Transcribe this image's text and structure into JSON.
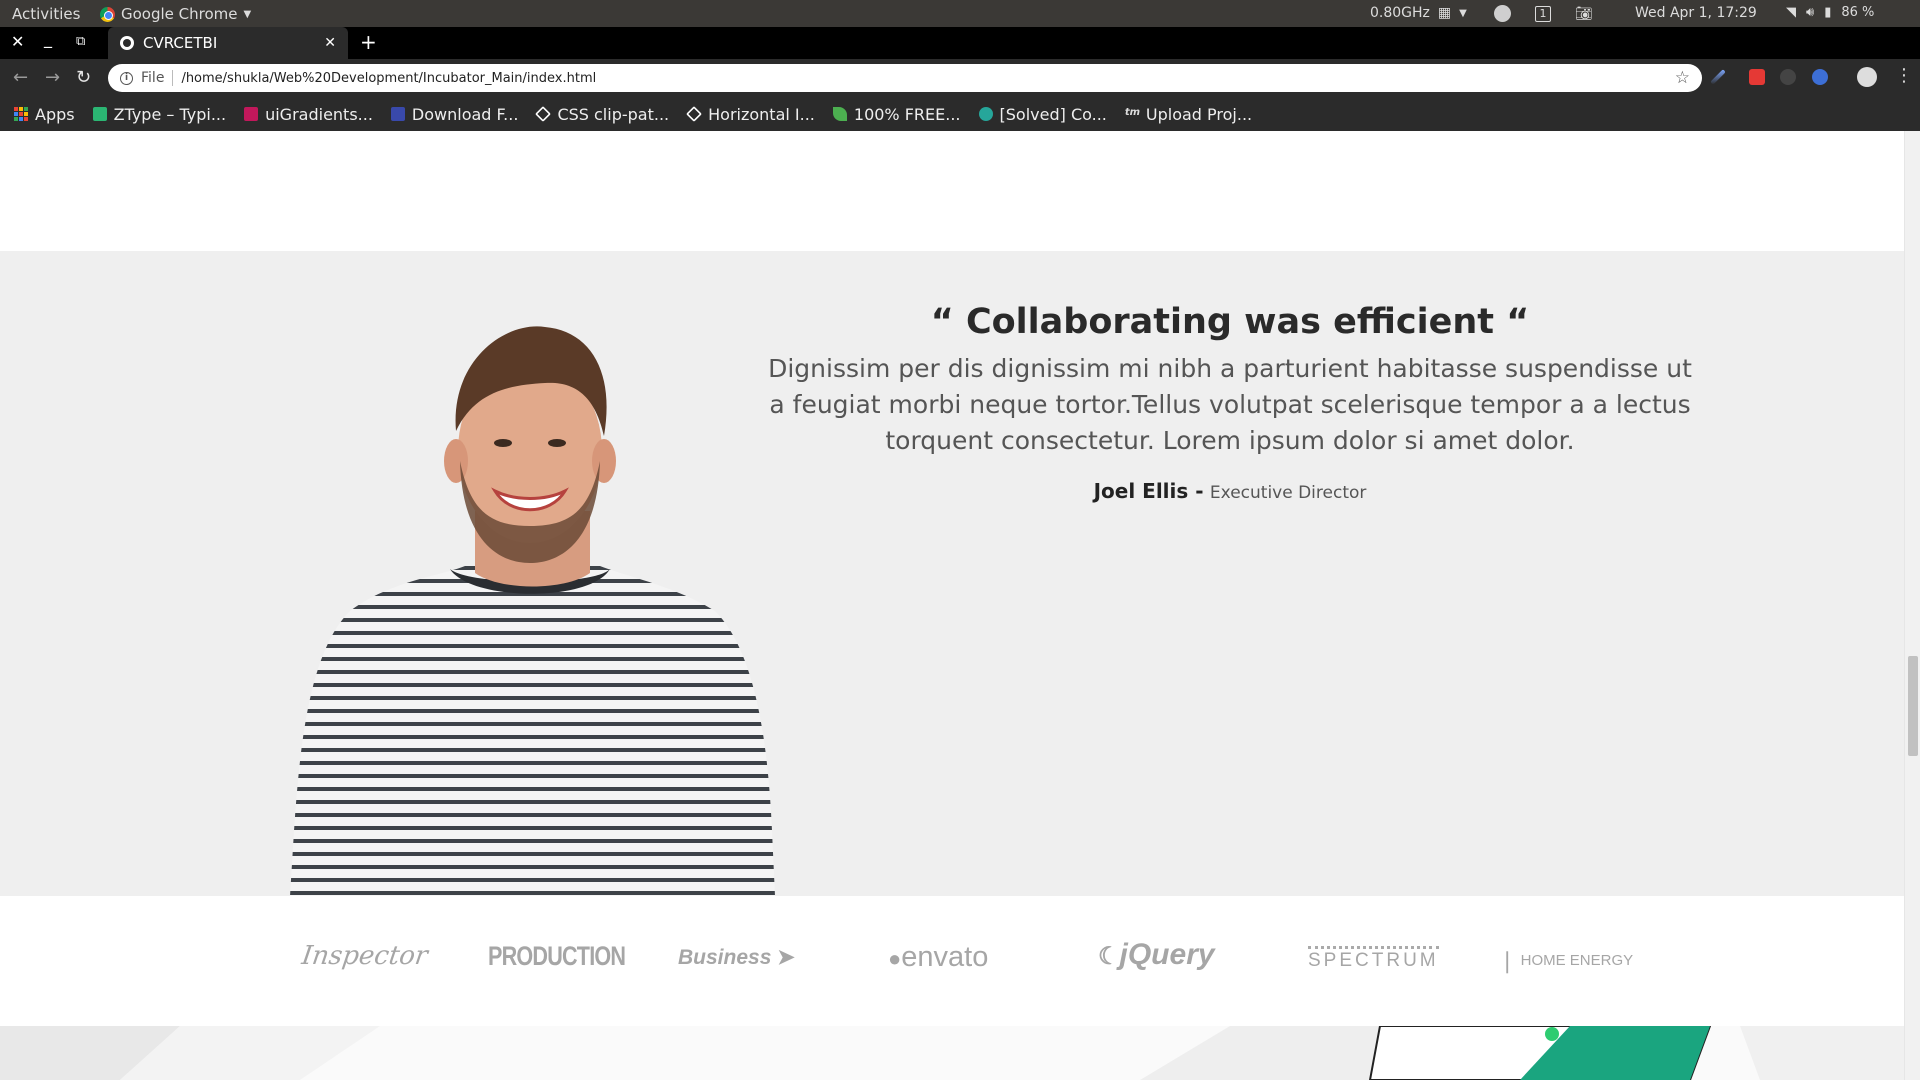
{
  "os_bar": {
    "activities": "Activities",
    "app_name": "Google Chrome",
    "cpu_freq": "0.80GHz",
    "workspace": "1",
    "clock": "Wed Apr  1, 17:29",
    "battery": "86 %"
  },
  "browser": {
    "tab_title": "CVRCETBI",
    "url_scheme": "File",
    "url": "/home/shukla/Web%20Development/Incubator_Main/index.html",
    "bookmarks": [
      {
        "label": "Apps",
        "icon": "apps-grid-icon"
      },
      {
        "label": "ZType – Typi...",
        "icon": "ztype-icon",
        "color": "#2bb673"
      },
      {
        "label": "uiGradients...",
        "icon": "uigradients-icon",
        "color": "#c2185b"
      },
      {
        "label": "Download F...",
        "icon": "download-icon",
        "color": "#3949ab"
      },
      {
        "label": "CSS clip-pat...",
        "icon": "codepen-icon",
        "color": "#ffffff"
      },
      {
        "label": "Horizontal I...",
        "icon": "codepen-icon",
        "color": "#ffffff"
      },
      {
        "label": "100% FREE...",
        "icon": "feather-icon",
        "color": "#4caf50"
      },
      {
        "label": "[Solved] Co...",
        "icon": "forum-icon",
        "color": "#26a69a"
      },
      {
        "label": "Upload Proj...",
        "icon": "tm-icon",
        "color": "#dddddd"
      }
    ]
  },
  "page": {
    "testimonial": {
      "title": "“ Collaborating was efficient “",
      "body": "Dignissim per dis dignissim mi nibh a parturient habitasse suspendisse ut a feugiat morbi neque tortor.Tellus volutpat scelerisque tempor a a lectus torquent consectetur. Lorem ipsum dolor si amet dolor.",
      "author": "Joel Ellis -",
      "role": "Executive Director"
    },
    "logos": [
      "Inspector",
      "PRODUCTION",
      "Business",
      "envato",
      "jQuery",
      "SPECTRUM",
      "HOME ENERGY"
    ],
    "scroll_fraction": 0.58
  }
}
